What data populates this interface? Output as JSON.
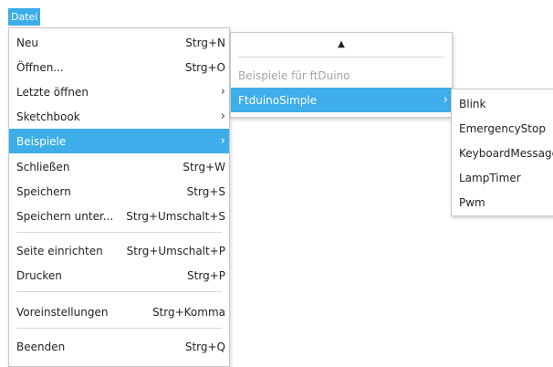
{
  "menubar": {
    "title": "Datei"
  },
  "file_menu": {
    "items": [
      {
        "label": "Neu",
        "shortcut": "Strg+N"
      },
      {
        "label": "Öffnen...",
        "shortcut": "Strg+O"
      },
      {
        "label": "Letzte öffnen",
        "submenu": true
      },
      {
        "label": "Sketchbook",
        "submenu": true
      },
      {
        "label": "Beispiele",
        "submenu": true,
        "highlighted": true
      },
      {
        "label": "Schließen",
        "shortcut": "Strg+W"
      },
      {
        "label": "Speichern",
        "shortcut": "Strg+S"
      },
      {
        "label": "Speichern unter...",
        "shortcut": "Strg+Umschalt+S"
      },
      {
        "label": "Seite einrichten",
        "shortcut": "Strg+Umschalt+P"
      },
      {
        "label": "Drucken",
        "shortcut": "Strg+P"
      },
      {
        "label": "Voreinstellungen",
        "shortcut": "Strg+Komma"
      },
      {
        "label": "Beenden",
        "shortcut": "Strg+Q"
      }
    ]
  },
  "examples_menu": {
    "scroll_up_icon": "triangle-up",
    "section_header": "Beispiele für ftDuino",
    "items": [
      {
        "label": "FtduinoSimple",
        "submenu": true,
        "highlighted": true
      }
    ]
  },
  "ftduinosimple_menu": {
    "items": [
      {
        "label": "Blink"
      },
      {
        "label": "EmergencyStop"
      },
      {
        "label": "KeyboardMessage"
      },
      {
        "label": "LampTimer"
      },
      {
        "label": "Pwm"
      }
    ]
  },
  "colors": {
    "highlight": "#3daee9",
    "disabled_text": "#a6a6a6"
  },
  "glyphs": {
    "chevron_right": "›",
    "triangle_up": "▲"
  }
}
